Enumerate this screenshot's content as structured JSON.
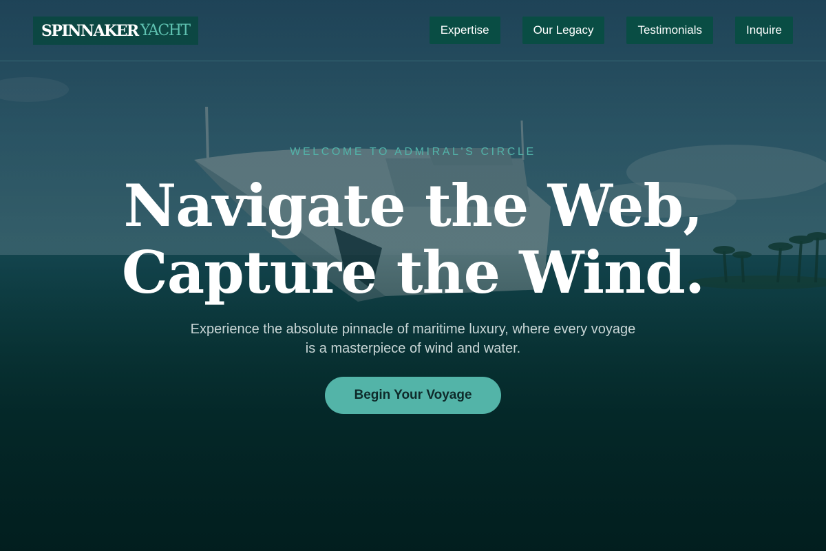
{
  "header": {
    "logo": {
      "primary": "SPINNAKER",
      "secondary": "YACHT"
    },
    "nav": [
      {
        "label": "Expertise"
      },
      {
        "label": "Our Legacy"
      },
      {
        "label": "Testimonials"
      },
      {
        "label": "Inquire"
      }
    ]
  },
  "hero": {
    "eyebrow": "WELCOME TO ADMIRAL'S CIRCLE",
    "title_line1": "Navigate the Web,",
    "title_line2": "Capture the Wind.",
    "subtitle": "Experience the absolute pinnacle of maritime luxury, where every voyage is a masterpiece of wind and water.",
    "cta_label": "Begin Your Voyage"
  },
  "colors": {
    "accent": "#53b4a8",
    "nav_bg": "#084e42",
    "text_primary": "#ffffff",
    "background_dark": "#0e2b30"
  }
}
